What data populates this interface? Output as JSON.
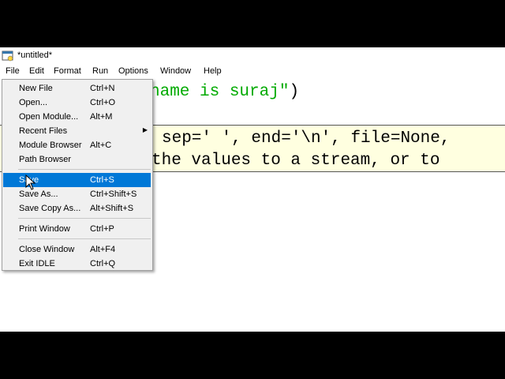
{
  "window": {
    "title": "*untitled*"
  },
  "menubar": {
    "items": [
      "File",
      "Edit",
      "Format",
      "Run",
      "Options",
      "Window",
      "Help"
    ]
  },
  "editor": {
    "line1_string": "name is suraj\")"
  },
  "calltip": {
    "line1": "sep=' ', end='\\n', file=None,",
    "line2": "the values to a stream, or to"
  },
  "file_menu": {
    "items": [
      {
        "label": "New File",
        "accel": "Ctrl+N"
      },
      {
        "label": "Open...",
        "accel": "Ctrl+O"
      },
      {
        "label": "Open Module...",
        "accel": "Alt+M"
      },
      {
        "label": "Recent Files",
        "accel": ""
      },
      {
        "label": "Module Browser",
        "accel": "Alt+C"
      },
      {
        "label": "Path Browser",
        "accel": ""
      },
      {
        "label": "Save",
        "accel": "Ctrl+S"
      },
      {
        "label": "Save As...",
        "accel": "Ctrl+Shift+S"
      },
      {
        "label": "Save Copy As...",
        "accel": "Alt+Shift+S"
      },
      {
        "label": "Print Window",
        "accel": "Ctrl+P"
      },
      {
        "label": "Close Window",
        "accel": "Alt+F4"
      },
      {
        "label": "Exit IDLE",
        "accel": "Ctrl+Q"
      }
    ],
    "selected": "Save"
  },
  "colors": {
    "string": "#00aa00",
    "selection": "#0078d7",
    "calltip_bg": "#ffffe0"
  }
}
